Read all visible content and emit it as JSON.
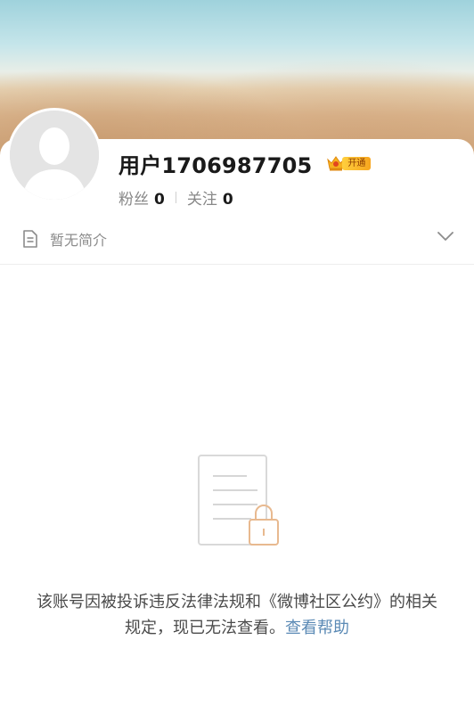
{
  "profile": {
    "username": "用户1706987705",
    "vip_badge_label": "开通",
    "fans_label": "粉丝",
    "fans_count": "0",
    "following_label": "关注",
    "following_count": "0"
  },
  "bio": {
    "text": "暂无简介"
  },
  "notice": {
    "message": "该账号因被投诉违反法律法规和《微博社区公约》的相关规定，现已无法查看。",
    "help_link_label": "查看帮助"
  },
  "colors": {
    "link": "#5b8ab5",
    "vip_gold": "#f7b21e",
    "illustration_accent": "#e8b98f"
  },
  "icons": {
    "bio": "document-icon",
    "expand": "chevron-down-icon",
    "vip": "vip-crown-icon",
    "empty_state": "locked-document-icon"
  }
}
